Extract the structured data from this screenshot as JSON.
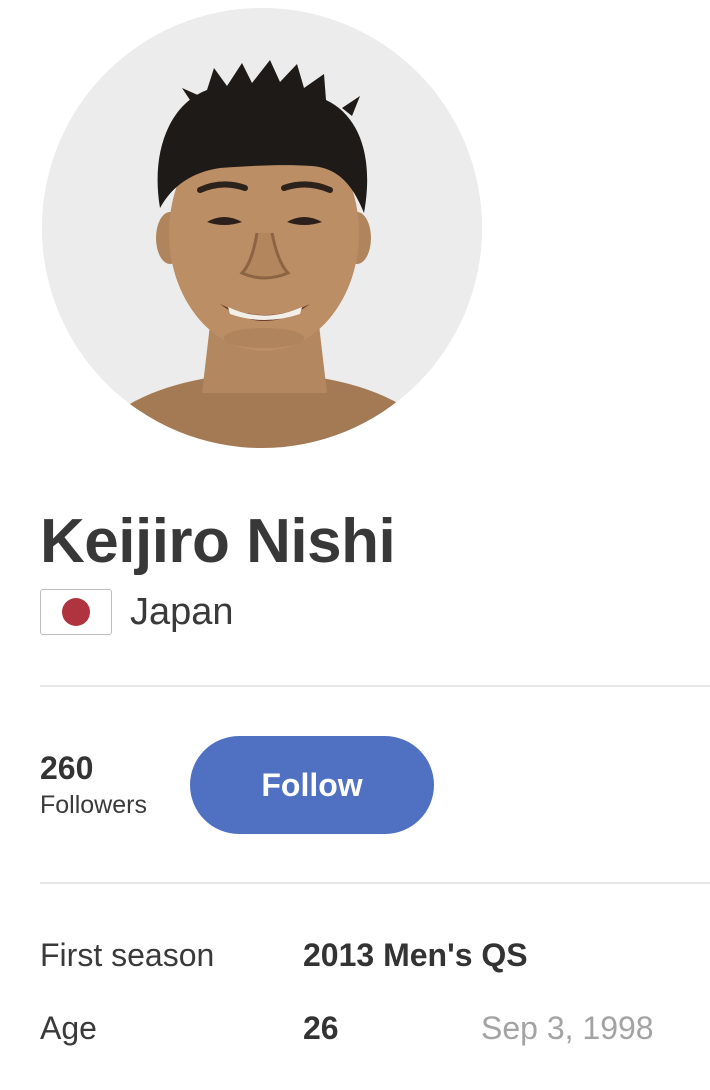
{
  "profile": {
    "name": "Keijiro Nishi",
    "country": "Japan",
    "flag_icon": "japan-flag-icon",
    "avatar_icon": "profile-photo"
  },
  "followers": {
    "count": "260",
    "label": "Followers"
  },
  "follow_button": {
    "label": "Follow",
    "color": "#5071c2"
  },
  "details": {
    "first_season": {
      "label": "First season",
      "value": "2013 Men's QS"
    },
    "age": {
      "label": "Age",
      "value": "26",
      "birthdate": "Sep 3, 1998"
    }
  }
}
